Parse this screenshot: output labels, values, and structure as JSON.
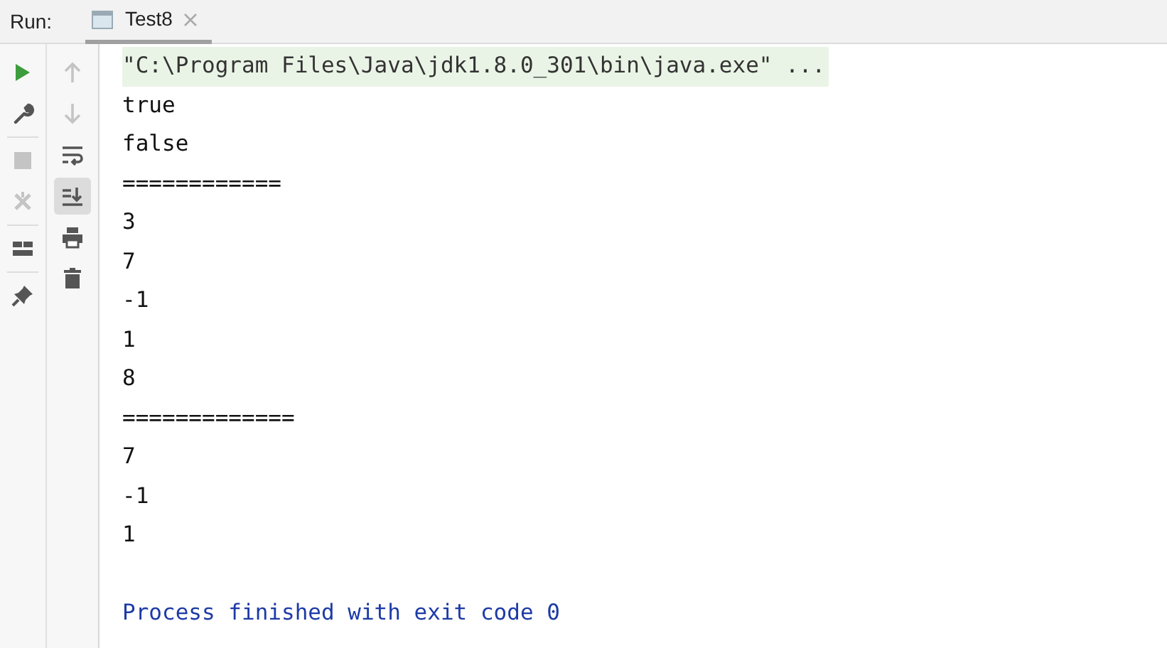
{
  "run_label": "Run:",
  "tabs": [
    {
      "label": "Test8",
      "selected": true
    }
  ],
  "left_toolbar": [
    {
      "kind": "run",
      "disabled": false
    },
    {
      "kind": "wrench",
      "disabled": false
    },
    {
      "kind": "separator"
    },
    {
      "kind": "stop",
      "disabled": true
    },
    {
      "kind": "rerun",
      "disabled": true
    },
    {
      "kind": "separator"
    },
    {
      "kind": "layout",
      "disabled": false
    },
    {
      "kind": "separator"
    },
    {
      "kind": "pin",
      "disabled": false
    }
  ],
  "console_toolbar": [
    {
      "kind": "up",
      "disabled": true,
      "selected": false
    },
    {
      "kind": "down",
      "disabled": true,
      "selected": false
    },
    {
      "kind": "wrap",
      "disabled": false,
      "selected": false
    },
    {
      "kind": "scroll-end",
      "disabled": false,
      "selected": true
    },
    {
      "kind": "print",
      "disabled": false,
      "selected": false
    },
    {
      "kind": "trash",
      "disabled": false,
      "selected": false
    }
  ],
  "console_lines": [
    {
      "kind": "command",
      "text": "\"C:\\Program Files\\Java\\jdk1.8.0_301\\bin\\java.exe\" ..."
    },
    {
      "kind": "output",
      "text": "true"
    },
    {
      "kind": "output",
      "text": "false"
    },
    {
      "kind": "output",
      "text": "============"
    },
    {
      "kind": "output",
      "text": "3"
    },
    {
      "kind": "output",
      "text": "7"
    },
    {
      "kind": "output",
      "text": "-1"
    },
    {
      "kind": "output",
      "text": "1"
    },
    {
      "kind": "output",
      "text": "8"
    },
    {
      "kind": "output",
      "text": "============="
    },
    {
      "kind": "output",
      "text": "7"
    },
    {
      "kind": "output",
      "text": "-1"
    },
    {
      "kind": "output",
      "text": "1"
    },
    {
      "kind": "blank"
    },
    {
      "kind": "system",
      "text": "Process finished with exit code 0"
    }
  ]
}
